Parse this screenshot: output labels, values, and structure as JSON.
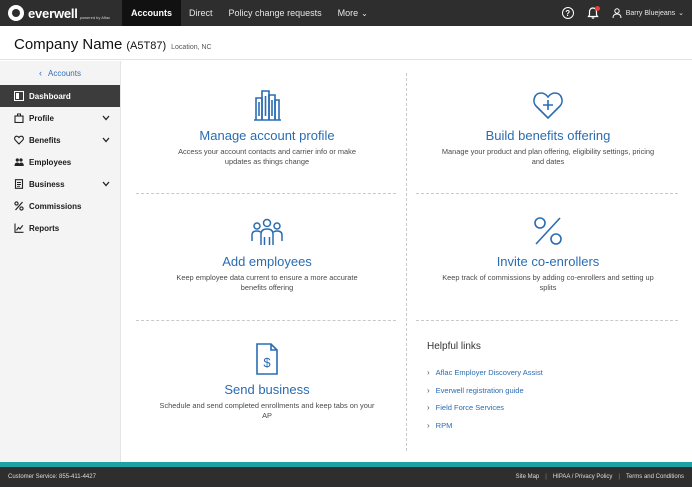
{
  "brand": {
    "name": "everwell",
    "tagline": "powered by Aflac"
  },
  "nav": {
    "tabs": [
      "Accounts",
      "Direct",
      "Policy change requests",
      "More"
    ],
    "more_caret": "⌄",
    "help_symbol": "?",
    "user_name": "Barry Bluejeans",
    "user_caret": "⌄"
  },
  "header": {
    "company_name": "Company Name",
    "company_code": "(A5T87)",
    "location": "Location, NC"
  },
  "sidebar": {
    "back_label": "Accounts",
    "items": [
      {
        "label": "Dashboard",
        "icon": "dashboard-icon",
        "active": true,
        "expandable": false
      },
      {
        "label": "Profile",
        "icon": "profile-icon",
        "active": false,
        "expandable": true
      },
      {
        "label": "Benefits",
        "icon": "heart-icon",
        "active": false,
        "expandable": true
      },
      {
        "label": "Employees",
        "icon": "employees-icon",
        "active": false,
        "expandable": false
      },
      {
        "label": "Business",
        "icon": "document-icon",
        "active": false,
        "expandable": true
      },
      {
        "label": "Commissions",
        "icon": "percent-icon",
        "active": false,
        "expandable": false
      },
      {
        "label": "Reports",
        "icon": "chart-icon",
        "active": false,
        "expandable": false
      }
    ]
  },
  "tiles": {
    "manage_profile": {
      "title": "Manage account profile",
      "desc": "Access your account contacts and carrier info or make updates as things change"
    },
    "build_benefits": {
      "title": "Build benefits offering",
      "desc": "Manage your product and plan offering, eligibility settings, pricing and dates"
    },
    "add_employees": {
      "title": "Add employees",
      "desc": "Keep employee data current to ensure a more accurate benefits offering"
    },
    "invite_coenrollers": {
      "title": "Invite co-enrollers",
      "desc": "Keep track of commissions by adding co-enrollers and setting up splits"
    },
    "send_business": {
      "title": "Send business",
      "desc": "Schedule and send completed enrollments and keep tabs on your AP"
    }
  },
  "helpful_links": {
    "title": "Helpful links",
    "links": [
      "Aflac Employer Discovery Assist",
      "Everwell registration guide",
      "Field Force Services",
      "RPM"
    ]
  },
  "footer": {
    "customer_service": "Customer Service:  855-411-4427",
    "links": [
      "Site Map",
      "HIPAA / Privacy Policy",
      "Terms and Conditions"
    ]
  },
  "colors": {
    "accent_blue": "#2a6cb3",
    "nav_dark": "#2e2e2e",
    "footer_teal": "#1fa1a3",
    "notification_red": "#e0433a"
  }
}
